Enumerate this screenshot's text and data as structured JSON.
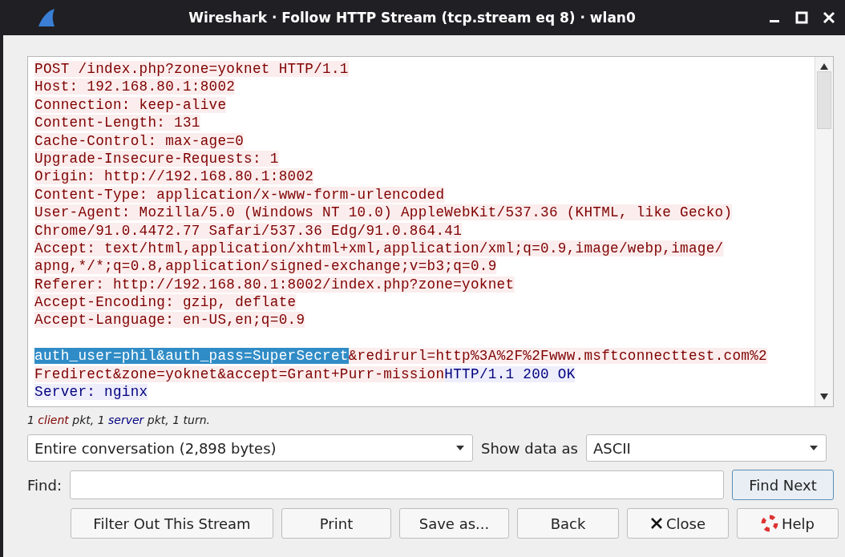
{
  "window": {
    "title": "Wireshark · Follow HTTP Stream (tcp.stream eq 8) · wlan0"
  },
  "stream": {
    "blocks": [
      {
        "lines": [
          [
            {
              "text": "POST /index.php?zone=yoknet HTTP/1.1",
              "kind": "client",
              "selected": false
            }
          ],
          [
            {
              "text": "Host: 192.168.80.1:8002",
              "kind": "client",
              "selected": false
            }
          ],
          [
            {
              "text": "Connection: keep-alive",
              "kind": "client",
              "selected": false
            }
          ],
          [
            {
              "text": "Content-Length: 131",
              "kind": "client",
              "selected": false
            }
          ],
          [
            {
              "text": "Cache-Control: max-age=0",
              "kind": "client",
              "selected": false
            }
          ],
          [
            {
              "text": "Upgrade-Insecure-Requests: 1",
              "kind": "client",
              "selected": false
            }
          ],
          [
            {
              "text": "Origin: http://192.168.80.1:8002",
              "kind": "client",
              "selected": false
            }
          ],
          [
            {
              "text": "Content-Type: application/x-www-form-urlencoded",
              "kind": "client",
              "selected": false
            }
          ],
          [
            {
              "text": "User-Agent: Mozilla/5.0 (Windows NT 10.0) AppleWebKit/537.36 (KHTML, like Gecko)",
              "kind": "client",
              "selected": false
            }
          ],
          [
            {
              "text": "Chrome/91.0.4472.77 Safari/537.36 Edg/91.0.864.41",
              "kind": "client",
              "selected": false
            }
          ],
          [
            {
              "text": "Accept: text/html,application/xhtml+xml,application/xml;q=0.9,image/webp,image/",
              "kind": "client",
              "selected": false
            }
          ],
          [
            {
              "text": "apng,*/*;q=0.8,application/signed-exchange;v=b3;q=0.9",
              "kind": "client",
              "selected": false
            }
          ],
          [
            {
              "text": "Referer: http://192.168.80.1:8002/index.php?zone=yoknet",
              "kind": "client",
              "selected": false
            }
          ],
          [
            {
              "text": "Accept-Encoding: gzip, deflate",
              "kind": "client",
              "selected": false
            }
          ],
          [
            {
              "text": "Accept-Language: en-US,en;q=0.9",
              "kind": "client",
              "selected": false
            }
          ]
        ]
      },
      {
        "lines": [
          [
            {
              "text": "auth_user=phil&auth_pass=SuperSecret",
              "kind": "client",
              "selected": true
            },
            {
              "text": "&redirurl=http%3A%2F%2Fwww.msftconnecttest.com%2",
              "kind": "client",
              "selected": false
            }
          ],
          [
            {
              "text": "Fredirect&zone=yoknet&accept=Grant+Purr-mission",
              "kind": "client",
              "selected": false
            },
            {
              "text": "HTTP/1.1 200 OK",
              "kind": "server",
              "selected": false
            }
          ],
          [
            {
              "text": "Server: nginx",
              "kind": "server",
              "selected": false
            }
          ]
        ]
      }
    ]
  },
  "summary": [
    {
      "text": "1 ",
      "kind": "plain"
    },
    {
      "text": "client",
      "kind": "client"
    },
    {
      "text": " pkt, 1 ",
      "kind": "plain"
    },
    {
      "text": "server",
      "kind": "server"
    },
    {
      "text": " pkt, 1 turn.",
      "kind": "plain"
    }
  ],
  "conversation_select": {
    "value": "Entire conversation (2,898 bytes)"
  },
  "show_data_label": "Show data as",
  "format_select": {
    "value": "ASCII"
  },
  "find": {
    "label": "Find:"
  },
  "find_next": {
    "label": "Find Next",
    "focused": true
  },
  "buttons": [
    {
      "label": "Filter Out This Stream",
      "kind": "plain"
    },
    {
      "label": "Print",
      "kind": "plain"
    },
    {
      "label": "Save as...",
      "kind": "plain"
    },
    {
      "label": "Back",
      "kind": "plain"
    },
    {
      "label": "Close",
      "kind": "close"
    },
    {
      "label": "Help",
      "kind": "help"
    }
  ]
}
